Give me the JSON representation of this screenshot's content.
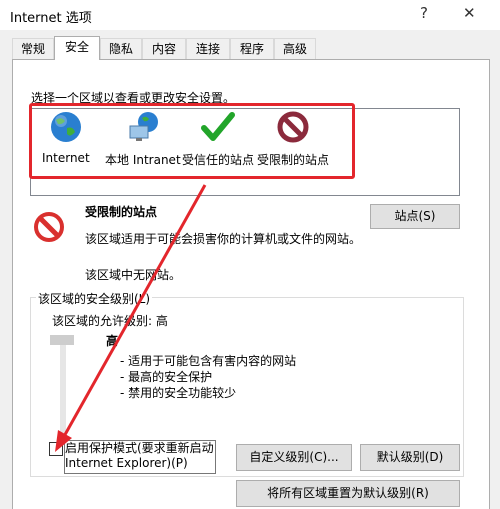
{
  "window": {
    "title": "Internet 选项",
    "help": "?",
    "close": "✕"
  },
  "tabs": [
    {
      "label": "常规"
    },
    {
      "label": "安全"
    },
    {
      "label": "隐私"
    },
    {
      "label": "内容"
    },
    {
      "label": "连接"
    },
    {
      "label": "程序"
    },
    {
      "label": "高级"
    }
  ],
  "active_tab": 1,
  "instruction": "选择一个区域以查看或更改安全设置。",
  "zones": [
    {
      "label": "Internet",
      "icon": "globe-icon"
    },
    {
      "label": "本地 Intranet",
      "icon": "network-computer-icon"
    },
    {
      "label": "受信任的站点",
      "icon": "checkmark-icon"
    },
    {
      "label": "受限制的站点",
      "icon": "restricted-icon"
    }
  ],
  "selected_zone": {
    "title": "受限制的站点",
    "description": "该区域适用于可能会损害你的计算机或文件的网站。",
    "note": "该区域中无网站。",
    "sites_button": "站点(S)"
  },
  "security_level": {
    "group_title": "该区域的安全级别(L)",
    "allowed_label": "该区域的允许级别: 高",
    "level_name": "高",
    "bullets": [
      "- 适用于可能包含有害内容的网站",
      "- 最高的安全保护",
      "- 禁用的安全功能较少"
    ]
  },
  "protected_mode": {
    "line1": "启用保护模式(要求重新启动",
    "line2": "Internet Explorer)(P)",
    "checked": false
  },
  "buttons": {
    "custom": "自定义级别(C)...",
    "default": "默认级别(D)",
    "reset_all": "将所有区域重置为默认级别(R)"
  },
  "colors": {
    "annotation_red": "#e3262c"
  }
}
